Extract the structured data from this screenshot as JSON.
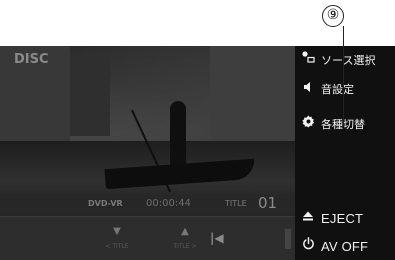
{
  "callout": {
    "number": "⑨"
  },
  "screen": {
    "source_label": "DISC",
    "status": {
      "format": "DVD-VR",
      "time": "00:00:44",
      "title_label": "TITLE",
      "title_number": "01"
    },
    "controls": {
      "title_down": {
        "symbol": "▼",
        "label": "< TITLE"
      },
      "title_up": {
        "symbol": "▲",
        "label": "TITLE >"
      },
      "skip_back": "|◀"
    }
  },
  "menu": {
    "source_select": {
      "icon": "source-select-icon",
      "label": "ソース選択"
    },
    "sound_settings": {
      "icon": "speaker-icon",
      "label": "音設定"
    },
    "settings": {
      "icon": "gear-icon",
      "label": "各種切替"
    },
    "eject": {
      "icon": "eject-icon",
      "label": "EJECT"
    },
    "av_off": {
      "icon": "power-icon",
      "label": "AV OFF"
    }
  }
}
